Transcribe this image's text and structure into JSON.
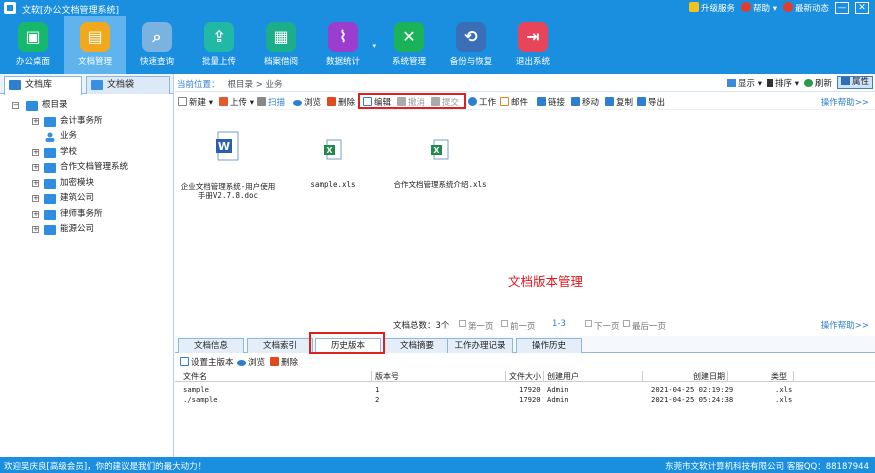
{
  "window": {
    "title": "文软[办公文档管理系统]"
  },
  "titlebar_right": {
    "upgrade": "升级服务",
    "help": "帮助",
    "news": "最新动态",
    "minimize": "—",
    "close": "✕"
  },
  "ribbon": [
    {
      "label": "办公桌面",
      "color": "#18b86c",
      "glyph": "▣",
      "icon": "desktop-icon"
    },
    {
      "label": "文档管理",
      "color": "#f2a81c",
      "glyph": "▤",
      "icon": "document-manage-icon"
    },
    {
      "label": "快速查询",
      "color": "#7ab2e0",
      "glyph": "⌕",
      "icon": "quick-search-icon"
    },
    {
      "label": "批量上传",
      "color": "#21b8a6",
      "glyph": "⇪",
      "icon": "batch-upload-icon"
    },
    {
      "label": "档案借阅",
      "color": "#1cae88",
      "glyph": "▦",
      "icon": "archive-borrow-icon"
    },
    {
      "label": "数据统计",
      "color": "#9b3ed0",
      "glyph": "⌇",
      "icon": "statistics-icon"
    },
    {
      "label": "系统管理",
      "color": "#1cb25a",
      "glyph": "✕",
      "icon": "system-manage-icon"
    },
    {
      "label": "备份与恢复",
      "color": "#3a6fb8",
      "glyph": "⟲",
      "icon": "backup-restore-icon"
    },
    {
      "label": "退出系统",
      "color": "#e8455a",
      "glyph": "⇥",
      "icon": "exit-icon"
    }
  ],
  "left_tabs": {
    "library": "文档库",
    "bag": "文档袋"
  },
  "tree": {
    "root": "根目录",
    "items": [
      "会计事务所",
      "业务",
      "学校",
      "合作文档管理系统",
      "加密模块",
      "建筑公司",
      "律师事务所",
      "能源公司"
    ]
  },
  "breadcrumb": {
    "prefix": "当前位置：",
    "path": "根目录 > 业务"
  },
  "view_controls": {
    "display": "显示",
    "sort": "排序",
    "refresh": "刷新",
    "properties": "属性"
  },
  "toolbar": {
    "new": "新建",
    "upload": "上传",
    "scan": "扫描",
    "browse": "浏览",
    "delete": "删除",
    "edit": "编辑",
    "cancel": "撤消",
    "submit": "提交",
    "work": "工作",
    "mail": "邮件",
    "link": "链接",
    "move": "移动",
    "copy": "复制",
    "export": "导出",
    "help": "操作帮助>>"
  },
  "files": [
    {
      "name": "企业文档管理系统-用户使用手册V2.7.8.doc",
      "line1": "企业文档管理系统-用户使用",
      "line2": "手册V2.7.8.doc",
      "type": "word"
    },
    {
      "name": "sample.xls",
      "line1": "sample.xls",
      "line2": "",
      "type": "excel"
    },
    {
      "name": "合作文档管理系统介绍.xls",
      "line1": "合作文档管理系统介绍.xls",
      "line2": "",
      "type": "excel"
    }
  ],
  "watermark": "文档版本管理",
  "pager": {
    "total": "文档总数：3个",
    "first": "第一页",
    "prev": "前一页",
    "range": "1-3",
    "next": "下一页",
    "last": "最后一页",
    "help": "操作帮助>>"
  },
  "bottom_tabs": [
    "文档信息",
    "文档索引",
    "历史版本",
    "文档摘要",
    "工作办理记录",
    "操作历史"
  ],
  "bottom_toolbar": {
    "set_main": "设置主版本",
    "browse": "浏览",
    "delete": "删除"
  },
  "versions": {
    "columns": [
      "文件名",
      "版本号",
      "文件大小",
      "创建用户",
      "创建日期",
      "类型"
    ],
    "rows": [
      {
        "name": "sample",
        "version": "1",
        "size": "17920",
        "user": "Admin",
        "date": "2021-04-25 02:19:29",
        "type": ".xls"
      },
      {
        "name": "./sample",
        "version": "2",
        "size": "17920",
        "user": "Admin",
        "date": "2021-04-25 05:24:38",
        "type": ".xls"
      }
    ]
  },
  "statusbar": {
    "left": "欢迎吴庆良[高级会员]，你的建议是我们的最大动力！",
    "right": "东莞市文软计算机科技有限公司 客服QQ：88187944"
  }
}
